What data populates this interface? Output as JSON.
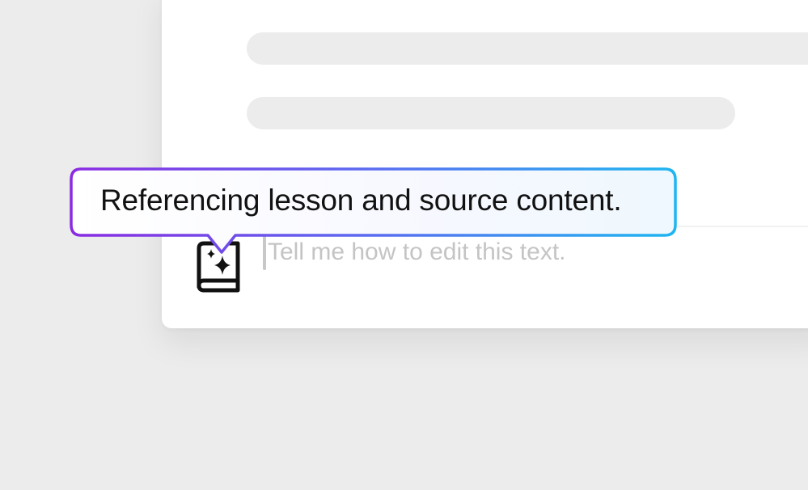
{
  "tooltip": {
    "text": "Referencing lesson and source content."
  },
  "prompt": {
    "placeholder": "Tell me how to edit this text.",
    "value": ""
  },
  "icons": {
    "reference": "book-sparkle-icon"
  },
  "colors": {
    "gradient_start": "#8a2be2",
    "gradient_mid": "#5a6cf0",
    "gradient_end": "#1fb6f0",
    "page_background": "#ececec",
    "card_background": "#ffffff",
    "skeleton": "#ececec"
  }
}
